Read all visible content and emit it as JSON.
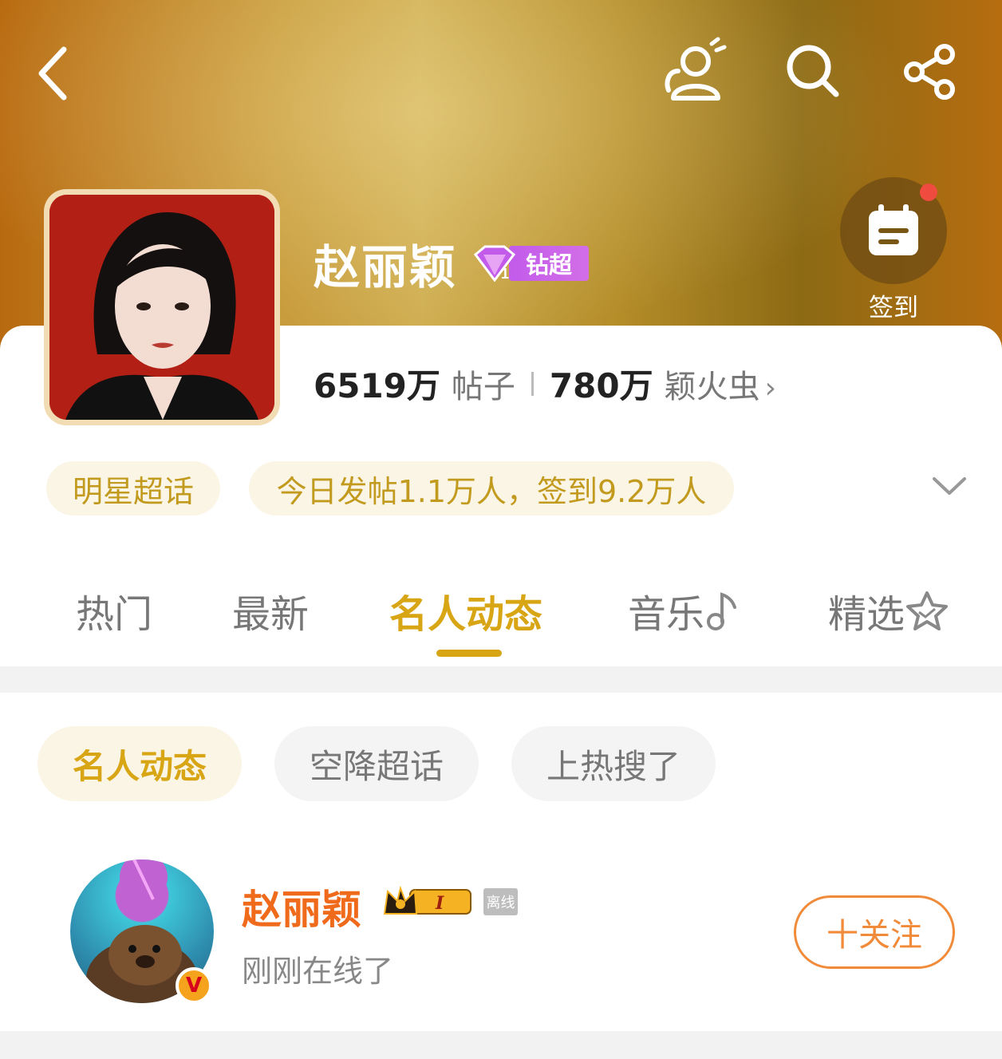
{
  "header": {
    "checkin_label": "签到",
    "bg_colors": [
      "#b86a10",
      "#cfae52",
      "#8c6a14"
    ]
  },
  "topic": {
    "name": "赵丽颖",
    "badge_level": "1",
    "badge_label": "钻超",
    "posts_count": "6519万",
    "posts_label": "帖子",
    "fans_count": "780万",
    "fans_label": "颖火虫",
    "fans_arrow": "›"
  },
  "pills": {
    "category": "明星超话",
    "today": "今日发帖1.1万人，签到9.2万人"
  },
  "tabs": [
    {
      "label": "热门"
    },
    {
      "label": "最新"
    },
    {
      "label": "名人动态"
    },
    {
      "label": "音乐"
    },
    {
      "label": "精选"
    }
  ],
  "active_tab": "名人动态",
  "chips": [
    {
      "label": "名人动态"
    },
    {
      "label": "空降超话"
    },
    {
      "label": "上热搜了"
    }
  ],
  "user_card": {
    "name": "赵丽颖",
    "level_badge": "I",
    "offline_label": "离线",
    "status": "刚刚在线了",
    "verified_mark": "V",
    "follow_label": "十关注"
  },
  "colors": {
    "accent": "#d8a515",
    "orange": "#f06a1c",
    "badge_purple": "#c25bea"
  }
}
